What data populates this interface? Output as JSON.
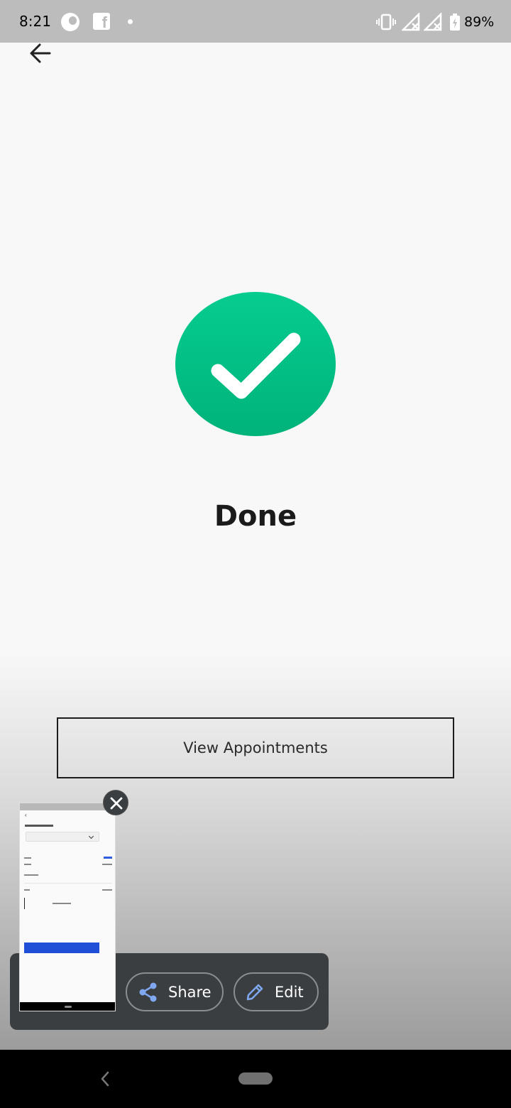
{
  "status_bar": {
    "time": "8:21",
    "battery": "89%",
    "icons": [
      "app-icon",
      "facebook-icon",
      "dot-icon",
      "vibrate-icon",
      "signal-off-icon",
      "signal-off-icon",
      "battery-charging-icon"
    ]
  },
  "header": {
    "back_icon": "arrow-left-icon"
  },
  "success": {
    "icon": "check-circle-icon",
    "icon_color": "#03C78C",
    "title": "Done"
  },
  "actions": {
    "view_appointments_label": "View Appointments"
  },
  "screenshot_preview": {
    "share_label": "Share",
    "edit_label": "Edit",
    "accent_icon_color": "#7FA8F0",
    "thumbnail_button_color": "#1F4FD6"
  },
  "navigation": {
    "back_icon": "nav-back-icon",
    "home_icon": "home-pill-icon"
  }
}
